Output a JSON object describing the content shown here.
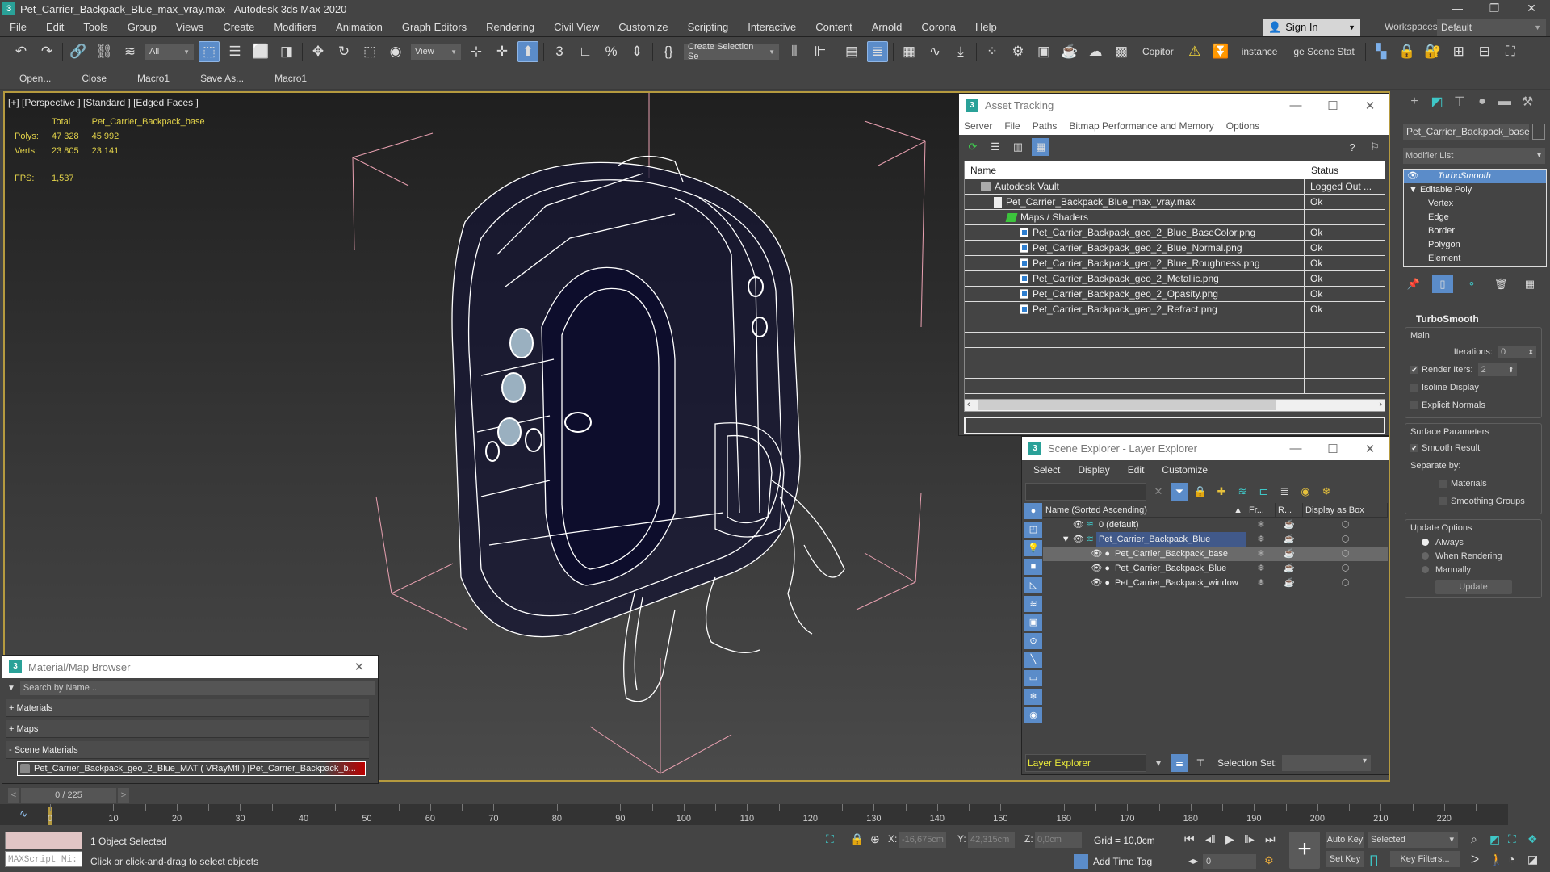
{
  "app": {
    "title": "Pet_Carrier_Backpack_Blue_max_vray.max - Autodesk 3ds Max 2020",
    "logo": "3",
    "window_buttons": [
      "—",
      "❐",
      "✕"
    ]
  },
  "menu": [
    "File",
    "Edit",
    "Tools",
    "Group",
    "Views",
    "Create",
    "Modifiers",
    "Animation",
    "Graph Editors",
    "Rendering",
    "Civil View",
    "Customize",
    "Scripting",
    "Interactive",
    "Content",
    "Arnold",
    "Corona",
    "Help"
  ],
  "account": {
    "sign_in": "Sign In",
    "workspaces_label": "Workspaces:",
    "workspace": "Default"
  },
  "toolbar": {
    "selection_filter": "All",
    "ref_coord": "View",
    "named_selection": "Create Selection Se",
    "copitor": "Copitor",
    "instance": "instance",
    "scene_states": "ge Scene Stat"
  },
  "macros": [
    "Open...",
    "Close",
    "Macro1",
    "Save As...",
    "Macro1"
  ],
  "viewport": {
    "label": "[+] [Perspective ] [Standard ] [Edged Faces ]",
    "stats": {
      "col_total": "Total",
      "col_object": "Pet_Carrier_Backpack_base",
      "polys_label": "Polys:",
      "polys_total": "47 328",
      "polys_object": "45 992",
      "verts_label": "Verts:",
      "verts_total": "23 805",
      "verts_object": "23 141",
      "fps_label": "FPS:",
      "fps": "1,537"
    }
  },
  "asset_tracking": {
    "title": "Asset Tracking",
    "menu": [
      "Server",
      "File",
      "Paths",
      "Bitmap Performance and Memory",
      "Options"
    ],
    "columns": [
      "Name",
      "Status"
    ],
    "rows": [
      {
        "name": "Autodesk Vault",
        "status": "Logged Out ...",
        "icon": "vault-icon",
        "indent": 1
      },
      {
        "name": "Pet_Carrier_Backpack_Blue_max_vray.max",
        "status": "Ok",
        "icon": "file-icon",
        "indent": 2
      },
      {
        "name": "Maps / Shaders",
        "status": "",
        "icon": "maps-icon",
        "indent": 3
      },
      {
        "name": "Pet_Carrier_Backpack_geo_2_Blue_BaseColor.png",
        "status": "Ok",
        "icon": "image-icon",
        "indent": 4
      },
      {
        "name": "Pet_Carrier_Backpack_geo_2_Blue_Normal.png",
        "status": "Ok",
        "icon": "image-icon",
        "indent": 4
      },
      {
        "name": "Pet_Carrier_Backpack_geo_2_Blue_Roughness.png",
        "status": "Ok",
        "icon": "image-icon",
        "indent": 4
      },
      {
        "name": "Pet_Carrier_Backpack_geo_2_Metallic.png",
        "status": "Ok",
        "icon": "image-icon",
        "indent": 4
      },
      {
        "name": "Pet_Carrier_Backpack_geo_2_Opasity.png",
        "status": "Ok",
        "icon": "image-icon",
        "indent": 4
      },
      {
        "name": "Pet_Carrier_Backpack_geo_2_Refract.png",
        "status": "Ok",
        "icon": "image-icon",
        "indent": 4
      }
    ]
  },
  "scene_explorer": {
    "title": "Scene Explorer - Layer Explorer",
    "menu": [
      "Select",
      "Display",
      "Edit",
      "Customize"
    ],
    "columns": [
      "Name (Sorted Ascending)",
      "Fr...",
      "R...",
      "Display as Box"
    ],
    "rows": [
      {
        "name": "0 (default)",
        "level": 0,
        "state": ""
      },
      {
        "name": "Pet_Carrier_Backpack_Blue",
        "level": 0,
        "state": "sel",
        "expanded": true
      },
      {
        "name": "Pet_Carrier_Backpack_base",
        "level": 1,
        "state": "hl"
      },
      {
        "name": "Pet_Carrier_Backpack_Blue",
        "level": 1,
        "state": ""
      },
      {
        "name": "Pet_Carrier_Backpack_window",
        "level": 1,
        "state": ""
      }
    ],
    "explorer_type": "Layer Explorer",
    "selection_set_label": "Selection Set:"
  },
  "command_panel": {
    "object_name": "Pet_Carrier_Backpack_base",
    "modifier_list": "Modifier List",
    "stack": [
      "TurboSmooth",
      "Editable Poly",
      "Vertex",
      "Edge",
      "Border",
      "Polygon",
      "Element"
    ],
    "turbosmooth": {
      "title": "TurboSmooth",
      "main": "Main",
      "iterations_label": "Iterations:",
      "iterations": "0",
      "render_iters_label": "Render Iters:",
      "render_iters": "2",
      "render_iters_checked": true,
      "isoline": "Isoline Display",
      "explicit_normals": "Explicit Normals",
      "surface_params": "Surface Parameters",
      "smooth_result": "Smooth Result",
      "smooth_result_checked": true,
      "separate_by": "Separate by:",
      "materials": "Materials",
      "smoothing_groups": "Smoothing Groups",
      "update_options": "Update Options",
      "always": "Always",
      "when_rendering": "When Rendering",
      "manually": "Manually",
      "update_btn": "Update",
      "update_mode": "Always"
    }
  },
  "material_browser": {
    "title": "Material/Map Browser",
    "search_placeholder": "Search by Name ...",
    "sections": [
      "+ Materials",
      "+ Maps",
      "- Scene Materials"
    ],
    "item": "Pet_Carrier_Backpack_geo_2_Blue_MAT ( VRayMtl ) [Pet_Carrier_Backpack_b..."
  },
  "timeline": {
    "frame_display": "0 / 225",
    "current_frame": 0,
    "total_frames": 225,
    "tick_labels": [
      0,
      10,
      20,
      30,
      40,
      50,
      60,
      70,
      80,
      90,
      100,
      110,
      120,
      130,
      140,
      150,
      160,
      170,
      180,
      190,
      200,
      210,
      220
    ]
  },
  "status": {
    "maxscript": "MAXScript Mi:",
    "selection": "1 Object Selected",
    "prompt": "Click or click-and-drag to select objects",
    "x_label": "X:",
    "x": "-16,675cm",
    "y_label": "Y:",
    "y": "42,315cm",
    "z_label": "Z:",
    "z": "0,0cm",
    "grid": "Grid = 10,0cm",
    "add_time_tag": "Add Time Tag",
    "frame": "0",
    "auto_key": "Auto Key",
    "set_key": "Set Key",
    "key_mode": "Selected",
    "key_filters": "Key Filters..."
  },
  "colors": {
    "accent": "#5b8cc9",
    "viewport_border": "#b59a3f",
    "stats_text": "#e3d34a"
  }
}
